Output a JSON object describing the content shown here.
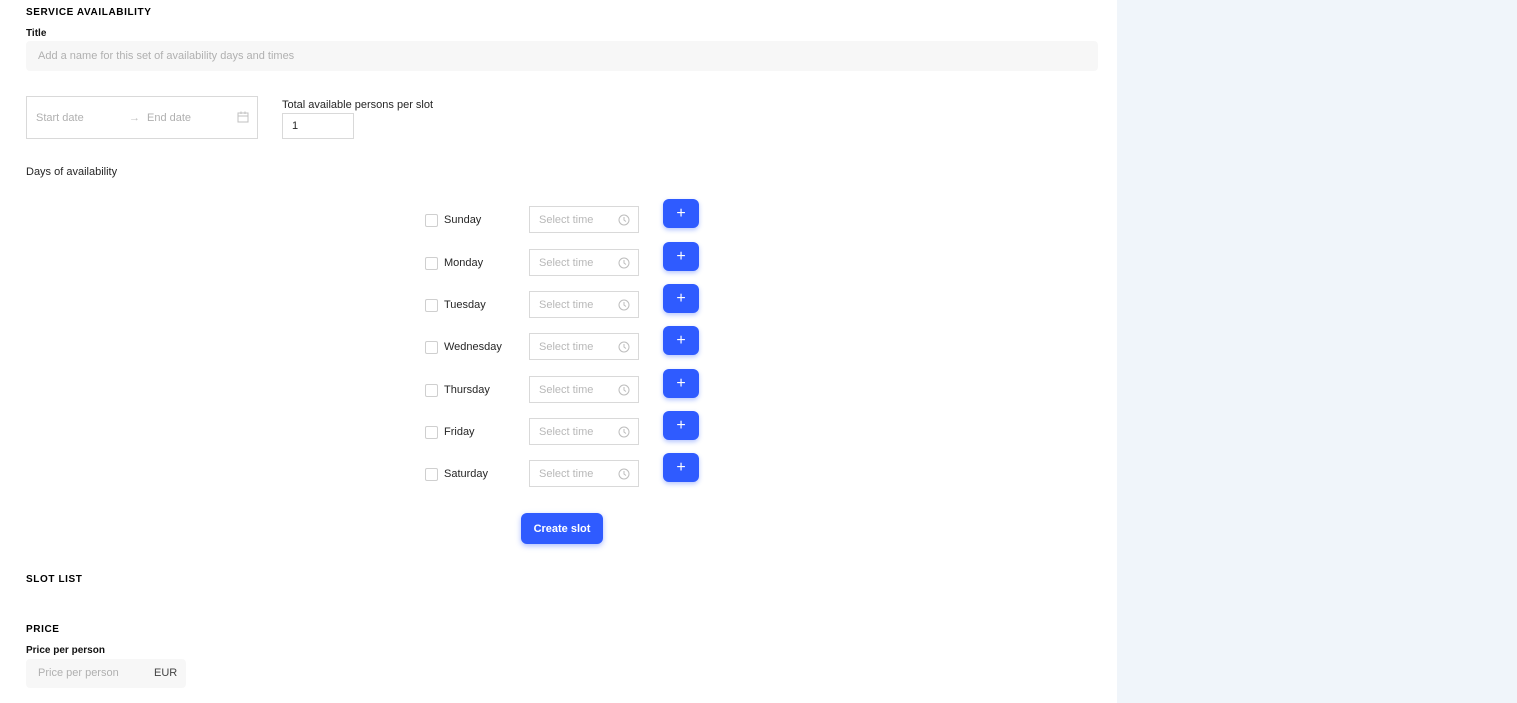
{
  "availability": {
    "heading": "SERVICE AVAILABILITY",
    "title_label": "Title",
    "title_placeholder": "Add a name for this set of availability days and times",
    "start_date_placeholder": "Start date",
    "end_date_placeholder": "End date",
    "persons_label": "Total available persons per slot",
    "persons_value": "1",
    "days_label": "Days of availability",
    "time_placeholder": "Select time",
    "add_label": "+",
    "days": [
      "Sunday",
      "Monday",
      "Tuesday",
      "Wednesday",
      "Thursday",
      "Friday",
      "Saturday"
    ],
    "create_label": "Create slot"
  },
  "slot_list": {
    "heading": "SLOT LIST"
  },
  "price": {
    "heading": "PRICE",
    "label": "Price per person",
    "placeholder": "Price per person",
    "currency": "EUR"
  },
  "icons": {
    "date_separator": "arrow-right-icon",
    "date_picker": "calendar-icon",
    "time_picker": "clock-icon",
    "add_time": "plus-icon"
  },
  "colors": {
    "accent": "#2f5bff",
    "side_panel": "#f0f5fa"
  }
}
